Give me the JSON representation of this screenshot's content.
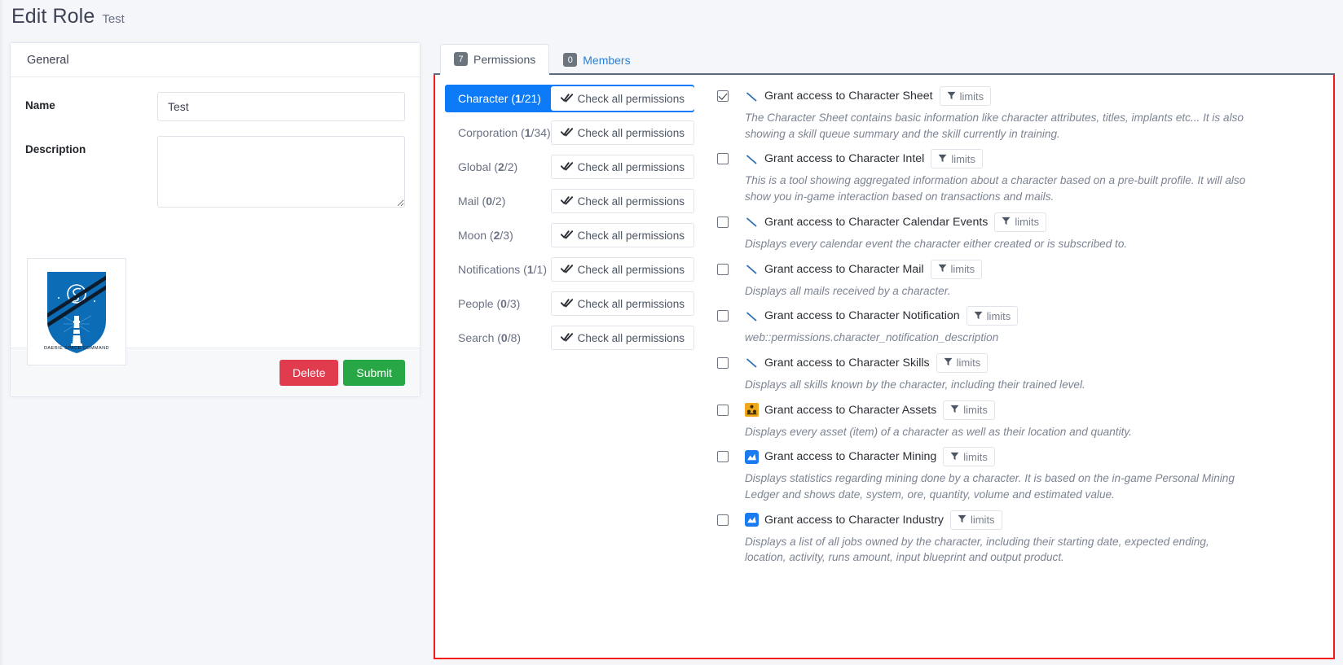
{
  "header": {
    "title": "Edit Role",
    "subtitle": "Test"
  },
  "general": {
    "card_title": "General",
    "name_label": "Name",
    "name_value": "Test",
    "description_label": "Description",
    "description_value": "",
    "description_placeholder": "",
    "emblem_text": "DAERIE SPACE COMMAND",
    "delete_label": "Delete",
    "submit_label": "Submit"
  },
  "tabs": [
    {
      "label": "Permissions",
      "badge": "7",
      "active": true
    },
    {
      "label": "Members",
      "badge": "0",
      "active": false
    }
  ],
  "categories": [
    {
      "name": "Character",
      "selected": "1",
      "total": "21",
      "active": true,
      "button": "Check all permissions"
    },
    {
      "name": "Corporation",
      "selected": "1",
      "total": "34",
      "active": false,
      "button": "Check all permissions"
    },
    {
      "name": "Global",
      "selected": "2",
      "total": "2",
      "active": false,
      "button": "Check all permissions"
    },
    {
      "name": "Mail",
      "selected": "0",
      "total": "2",
      "active": false,
      "button": "Check all permissions"
    },
    {
      "name": "Moon",
      "selected": "2",
      "total": "3",
      "active": false,
      "button": "Check all permissions"
    },
    {
      "name": "Notifications",
      "selected": "1",
      "total": "1",
      "active": false,
      "button": "Check all permissions"
    },
    {
      "name": "People",
      "selected": "0",
      "total": "3",
      "active": false,
      "button": "Check all permissions"
    },
    {
      "name": "Search",
      "selected": "0",
      "total": "8",
      "active": false,
      "button": "Check all permissions"
    }
  ],
  "limits_label": "limits",
  "permissions": [
    {
      "label": "Grant access to Character Sheet",
      "checked": true,
      "icon": "broken-image-icon",
      "description": "The Character Sheet contains basic information like character attributes, titles, implants etc... It is also showing a skill queue summary and the skill currently in training."
    },
    {
      "label": "Grant access to Character Intel",
      "checked": false,
      "icon": "broken-image-icon",
      "description": "This is a tool showing aggregated information about a character based on a pre-built profile. It will also show you in-game interaction based on transactions and mails."
    },
    {
      "label": "Grant access to Character Calendar Events",
      "checked": false,
      "icon": "broken-image-icon",
      "description": "Displays every calendar event the character either created or is subscribed to."
    },
    {
      "label": "Grant access to Character Mail",
      "checked": false,
      "icon": "broken-image-icon",
      "description": "Displays all mails received by a character."
    },
    {
      "label": "Grant access to Character Notification",
      "checked": false,
      "icon": "broken-image-icon",
      "description": "web::permissions.character_notification_description"
    },
    {
      "label": "Grant access to Character Skills",
      "checked": false,
      "icon": "broken-image-icon",
      "description": "Displays all skills known by the character, including their trained level."
    },
    {
      "label": "Grant access to Character Assets",
      "checked": false,
      "icon": "assets-icon",
      "description": "Displays every asset (item) of a character as well as their location and quantity."
    },
    {
      "label": "Grant access to Character Mining",
      "checked": false,
      "icon": "mining-icon",
      "description": "Displays statistics regarding mining done by a character. It is based on the in-game Personal Mining Ledger and shows date, system, ore, quantity, volume and estimated value."
    },
    {
      "label": "Grant access to Character Industry",
      "checked": false,
      "icon": "industry-icon",
      "description": "Displays a list of all jobs owned by the character, including their starting date, expected ending, location, activity, runs amount, input blueprint and output product."
    }
  ],
  "colors": {
    "accent": "#0d7bf7",
    "danger": "#e13b4e",
    "success": "#27a745",
    "highlight_border": "#f41a1a",
    "link": "#2a7fd4"
  }
}
